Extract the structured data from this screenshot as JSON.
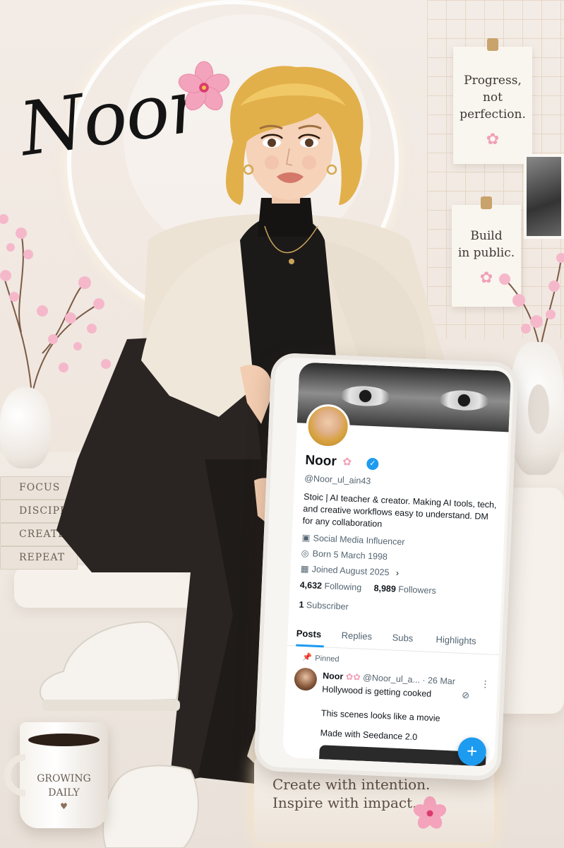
{
  "brand": {
    "title": "Noor"
  },
  "notes": [
    {
      "lines": [
        "Progress,",
        "not",
        "perfection."
      ]
    },
    {
      "lines": [
        "Build",
        "in public."
      ]
    }
  ],
  "books": [
    "FOCUS",
    "DISCIPLINE",
    "CREATE",
    "REPEAT"
  ],
  "mug": {
    "lines": [
      "GROWING",
      "DAILY"
    ],
    "heart": "♥"
  },
  "plaque": {
    "line1": "Create with intention.",
    "line2": "Inspire with impact."
  },
  "profile": {
    "name": "Noor",
    "handle": "@Noor_ul_ain43",
    "bio": "Stoic | AI teacher & creator. Making AI tools, tech, and creative workflows easy to understand. DM for any collaboration",
    "category": "Social Media Influencer",
    "born": "Born 5 March 1998",
    "joined": "Joined August 2025",
    "following_count": "4,632",
    "following_label": "Following",
    "followers_count": "8,989",
    "followers_label": "Followers",
    "subscriber_count": "1",
    "subscriber_label": "Subscriber",
    "tabs": [
      "Posts",
      "Replies",
      "Subs",
      "Highlights"
    ],
    "pinned_label": "Pinned",
    "post": {
      "author": "Noor",
      "handle_date": "@Noor_ul_a... · 26 Mar",
      "line1": "Hollywood is getting cooked",
      "line2": "This scenes looks like a movie",
      "line3": "Made with Seedance 2.0"
    },
    "fab": "+",
    "verified_icon": "✓"
  },
  "colors": {
    "accent": "#1d9bf0",
    "sakura": "#f4a9c0",
    "hair": "#e2b04a"
  }
}
